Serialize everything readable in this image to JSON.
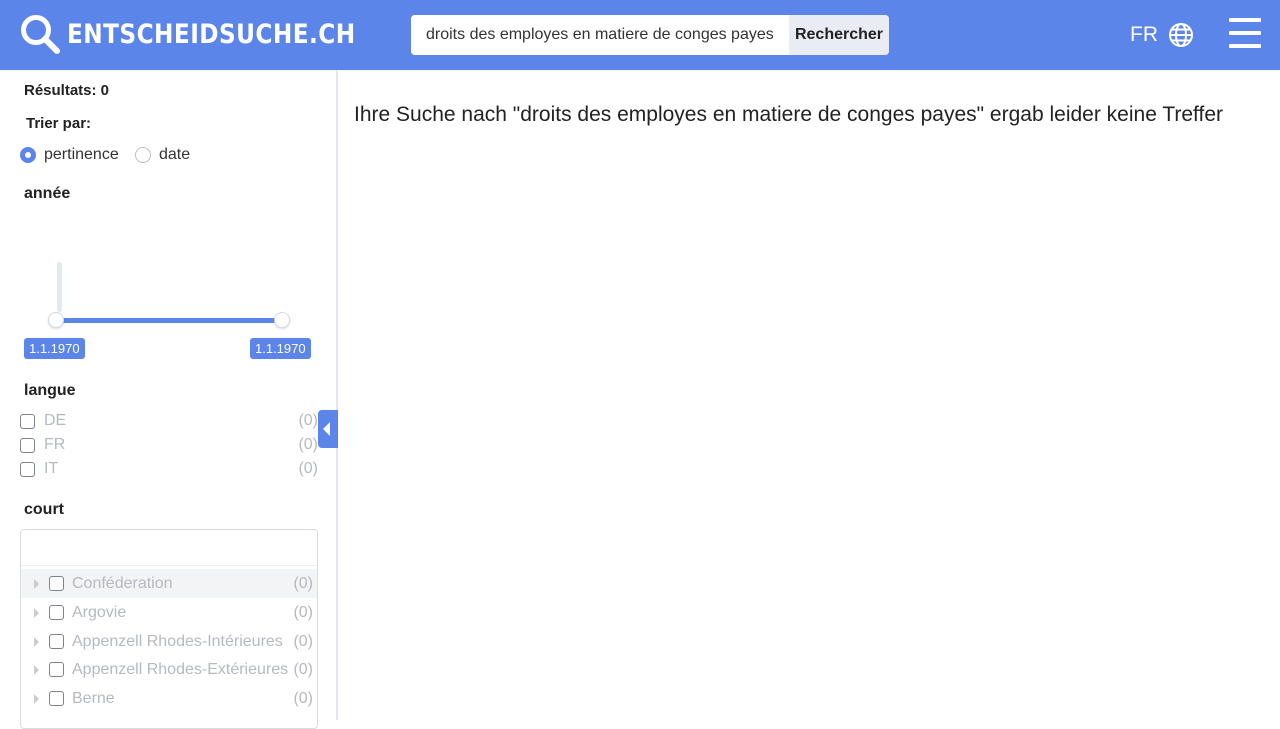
{
  "header": {
    "logo_text": "ENTSCHEIDSUCHE.CH",
    "search_value": "droits des employes en matiere de conges payes",
    "search_button": "Rechercher",
    "language": "FR",
    "brand_color": "#5c85ea"
  },
  "sidebar": {
    "result_count": "Résultats: 0",
    "sort_label": "Trier par:",
    "sort_options": [
      {
        "label": "pertinence",
        "checked": true
      },
      {
        "label": "date",
        "checked": false
      }
    ],
    "year_title": "année",
    "year_range": {
      "from": "1.1.1970",
      "to": "1.1.1970"
    },
    "language_title": "langue",
    "languages": [
      {
        "label": "DE",
        "count": "(0)"
      },
      {
        "label": "FR",
        "count": "(0)"
      },
      {
        "label": "IT",
        "count": "(0)"
      }
    ],
    "court_title": "court",
    "court_search_value": "",
    "courts": [
      {
        "label": "Conféderation",
        "count": "(0)"
      },
      {
        "label": "Argovie",
        "count": "(0)"
      },
      {
        "label": "Appenzell Rhodes-Intérieures",
        "count": "(0)"
      },
      {
        "label": "Appenzell Rhodes-Extérieures",
        "count": "(0)"
      },
      {
        "label": "Berne",
        "count": "(0)"
      }
    ]
  },
  "main": {
    "message": "Ihre Suche nach \"droits des employes en matiere de conges payes\" ergab leider keine Treffer"
  }
}
